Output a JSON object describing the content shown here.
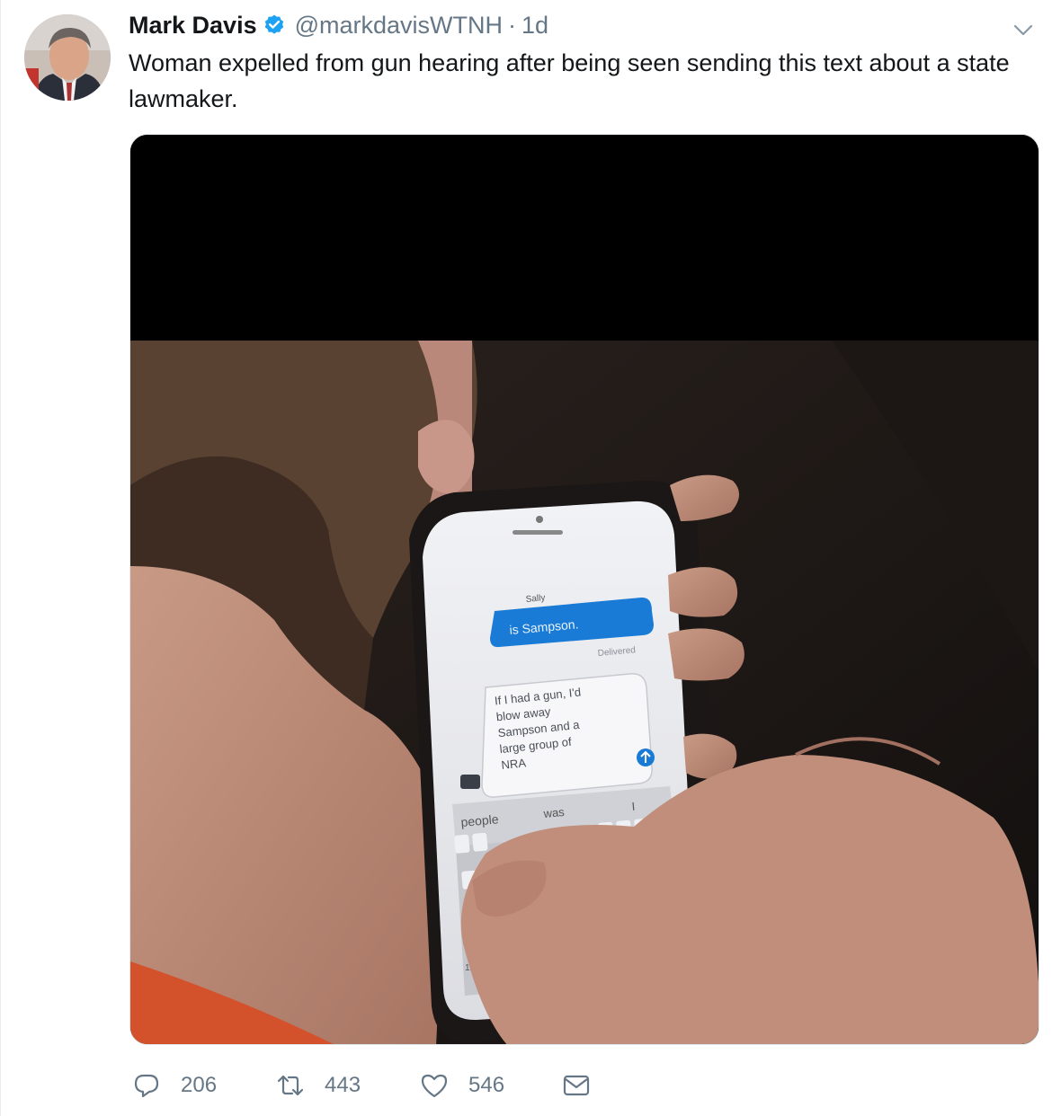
{
  "tweet": {
    "author_name": "Mark Davis",
    "handle": "@markdavisWTNH",
    "separator": "·",
    "time": "1d",
    "text": "Woman expelled from gun hearing after being seen sending this text about a state lawmaker."
  },
  "phone_screen": {
    "contact": "Sally",
    "sent_message": "is Sampson.",
    "delivered": "Delivered",
    "draft_text": "If I had a gun, I'd blow away Sampson and a large group of NRA",
    "suggestions": [
      "people",
      "was",
      "I"
    ],
    "keyboard_mode": "123"
  },
  "actions": {
    "reply_count": "206",
    "retweet_count": "443",
    "like_count": "546"
  },
  "icons": {
    "verified": "verified-badge-icon",
    "caret": "chevron-down-icon",
    "reply": "reply-icon",
    "retweet": "retweet-icon",
    "like": "heart-icon",
    "dm": "envelope-icon"
  },
  "colors": {
    "verified": "#1da1f2",
    "secondary_text": "#657786",
    "primary_text": "#14171a"
  }
}
